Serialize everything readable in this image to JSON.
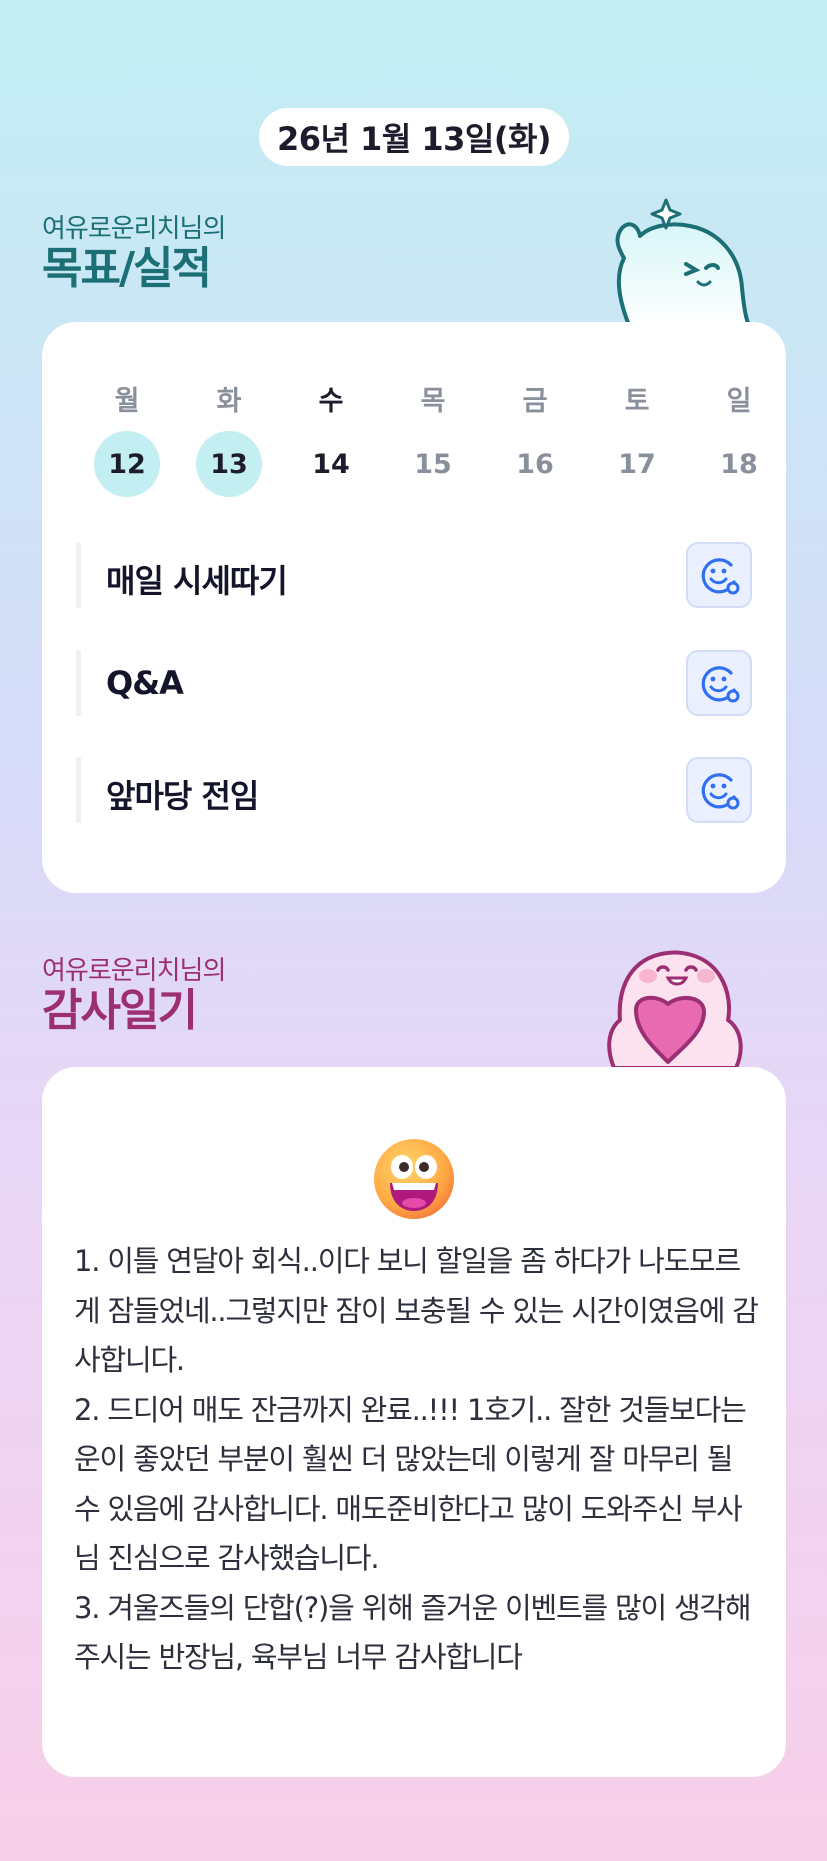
{
  "header": {
    "date_label": "26년 1월 13일(화)"
  },
  "goals_section": {
    "owner_label": "여유로운리치님의",
    "title": "목표/실적",
    "weekdays": [
      "월",
      "화",
      "수",
      "목",
      "금",
      "토",
      "일"
    ],
    "dates": [
      "12",
      "13",
      "14",
      "15",
      "16",
      "17",
      "18"
    ],
    "completed_dates": [
      "12",
      "13"
    ],
    "today": "14",
    "items": [
      {
        "label": "매일 시세따기",
        "icon": "smile-add-reaction-icon"
      },
      {
        "label": "Q&A",
        "icon": "smile-add-reaction-icon"
      },
      {
        "label": "앞마당 전임",
        "icon": "smile-add-reaction-icon"
      }
    ]
  },
  "diary_section": {
    "owner_label": "여유로운리치님의",
    "title": "감사일기",
    "emoji": "grinning-face-emoji",
    "entries": [
      "1. 이틀 연달아 회식..이다 보니 할일을 좀 하다가 나도모르게 잠들었네..그렇지만 잠이 보충될 수 있는 시간이였음에 감사합니다.",
      "2. 드디어 매도 잔금까지 완료..!!! 1호기.. 잘한 것들보다는 운이 좋았던 부분이 훨씬 더 많았는데 이렇게 잘 마무리 될 수 있음에 감사합니다. 매도준비한다고 많이 도와주신 부사님 진심으로 감사했습니다.",
      "3. 겨울즈들의 단합(?)을 위해 즐거운 이벤트를 많이 생각해주시는 반장님, 육부님 너무 감사합니다"
    ]
  },
  "colors": {
    "goal_title": "#1d6f76",
    "diary_title": "#9c2f73",
    "completed_day": "#c3eef2",
    "reaction_icon": "#2f6ff0"
  }
}
